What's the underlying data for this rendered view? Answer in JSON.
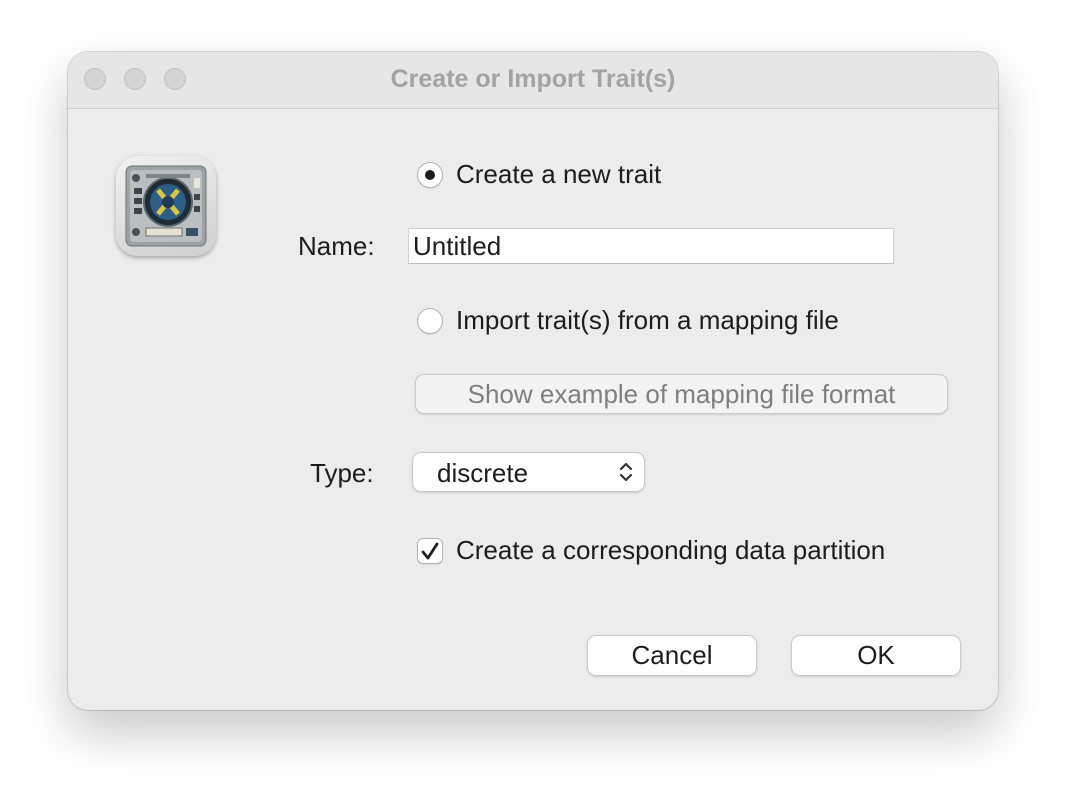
{
  "window": {
    "title": "Create or Import Trait(s)"
  },
  "form": {
    "create_option": {
      "label": "Create a new trait",
      "selected": true
    },
    "name": {
      "label": "Name:",
      "value": "Untitled"
    },
    "import_option": {
      "label": "Import trait(s) from a mapping file",
      "selected": false
    },
    "example_button": {
      "label": "Show example of mapping file format",
      "enabled": false
    },
    "type": {
      "label": "Type:",
      "selected": "discrete"
    },
    "partition_checkbox": {
      "label": "Create a corresponding data partition",
      "checked": true
    }
  },
  "buttons": {
    "cancel": "Cancel",
    "ok": "OK"
  },
  "icons": {
    "app": "app-icon",
    "select_arrows": "chevron-up-down-icon",
    "check": "checkmark-icon"
  }
}
